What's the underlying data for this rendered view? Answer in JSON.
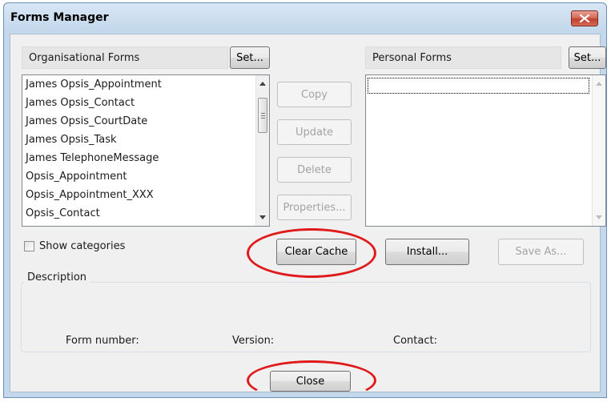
{
  "window": {
    "title": "Forms Manager"
  },
  "organisational": {
    "label": "Organisational Forms",
    "set_label": "Set...",
    "items": [
      "James Opsis_Appointment",
      "James Opsis_Contact",
      "James Opsis_CourtDate",
      "James Opsis_Task",
      "James TelephoneMessage",
      "Opsis_Appointment",
      "Opsis_Appointment_XXX",
      "Opsis_Contact"
    ]
  },
  "personal": {
    "label": "Personal Forms",
    "set_label": "Set...",
    "items": []
  },
  "actions": {
    "copy": "Copy",
    "update": "Update",
    "delete": "Delete",
    "properties": "Properties...",
    "clear_cache": "Clear Cache",
    "install": "Install...",
    "save_as": "Save As..."
  },
  "options": {
    "show_categories": "Show categories",
    "show_categories_checked": false
  },
  "description": {
    "legend": "Description",
    "form_number_label": "Form number:",
    "version_label": "Version:",
    "contact_label": "Contact:"
  },
  "footer": {
    "close": "Close"
  },
  "colors": {
    "annotation": "#e0191b",
    "title_bg": "#c4d8ec",
    "client_bg": "#f0f0f0"
  }
}
